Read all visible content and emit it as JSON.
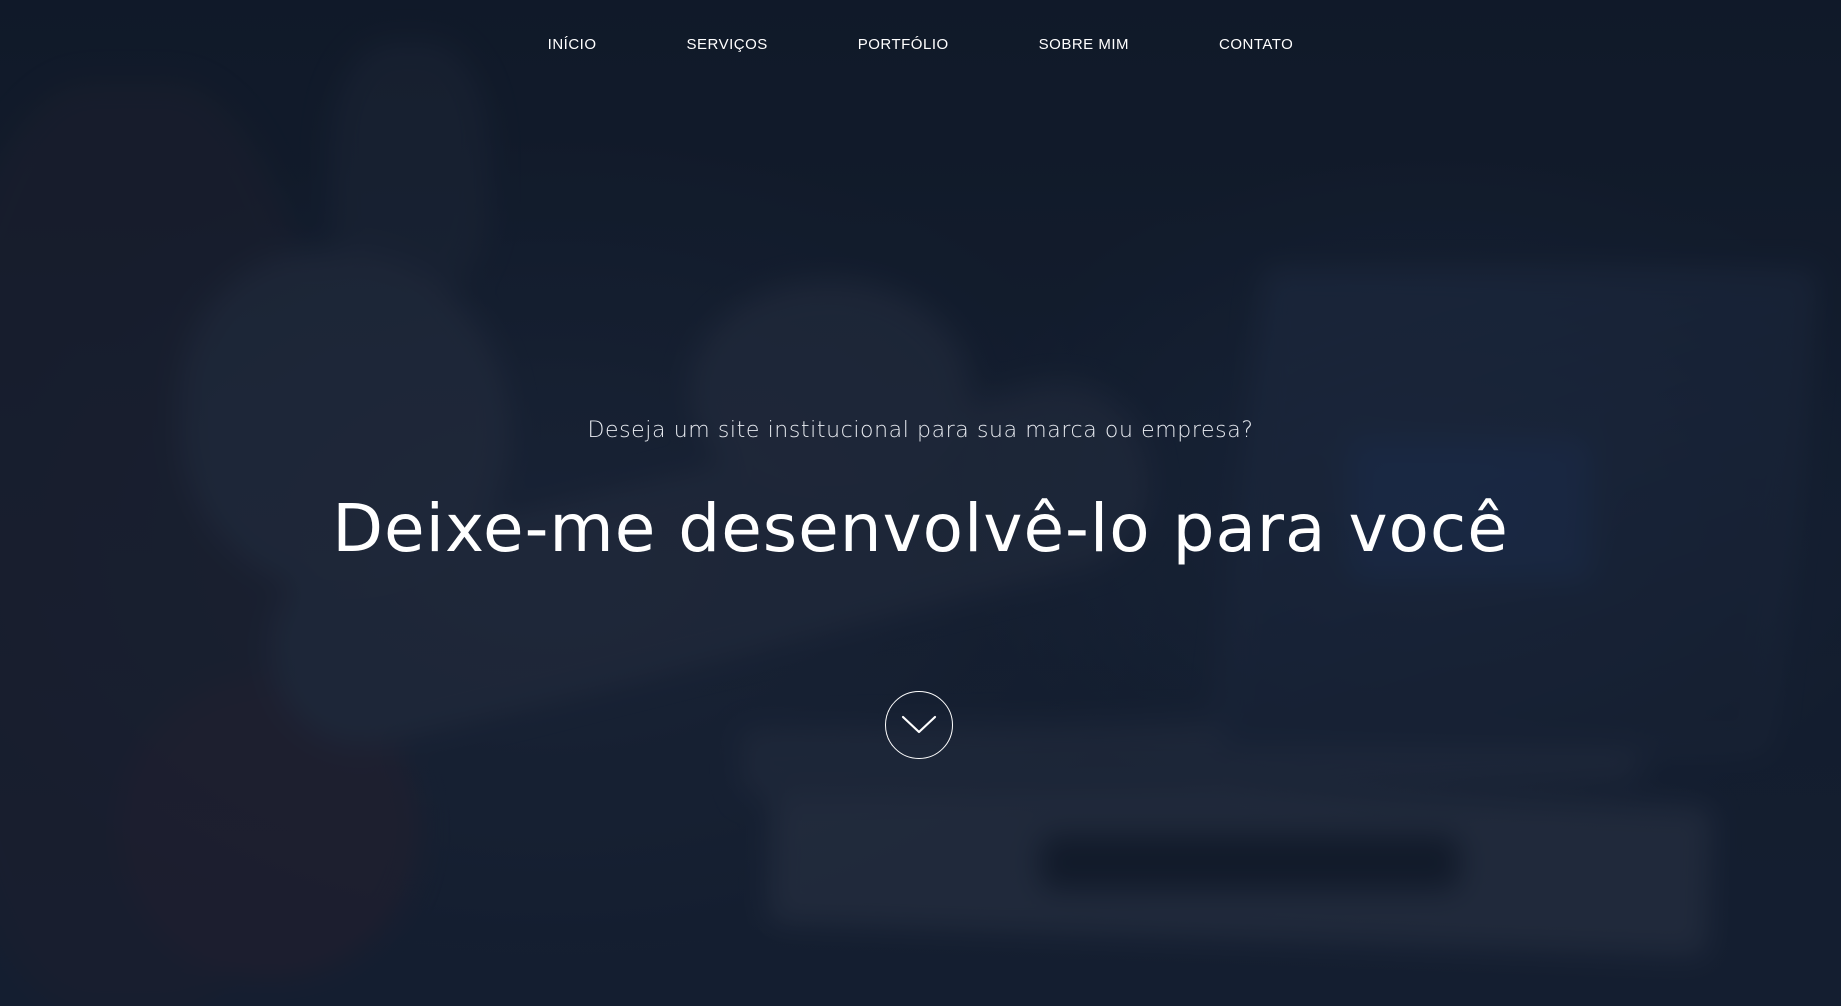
{
  "nav": {
    "items": [
      {
        "label": "INÍCIO"
      },
      {
        "label": "SERVIÇOS"
      },
      {
        "label": "PORTFÓLIO"
      },
      {
        "label": "SOBRE MIM"
      },
      {
        "label": "CONTATO"
      }
    ]
  },
  "hero": {
    "tagline": "Deseja um site institucional para sua marca ou empresa?",
    "headline": "Deixe-me desenvolvê-lo para você",
    "scroll_icon": "chevron-down-icon"
  },
  "colors": {
    "overlay": "#111a29",
    "text": "#ffffff"
  }
}
